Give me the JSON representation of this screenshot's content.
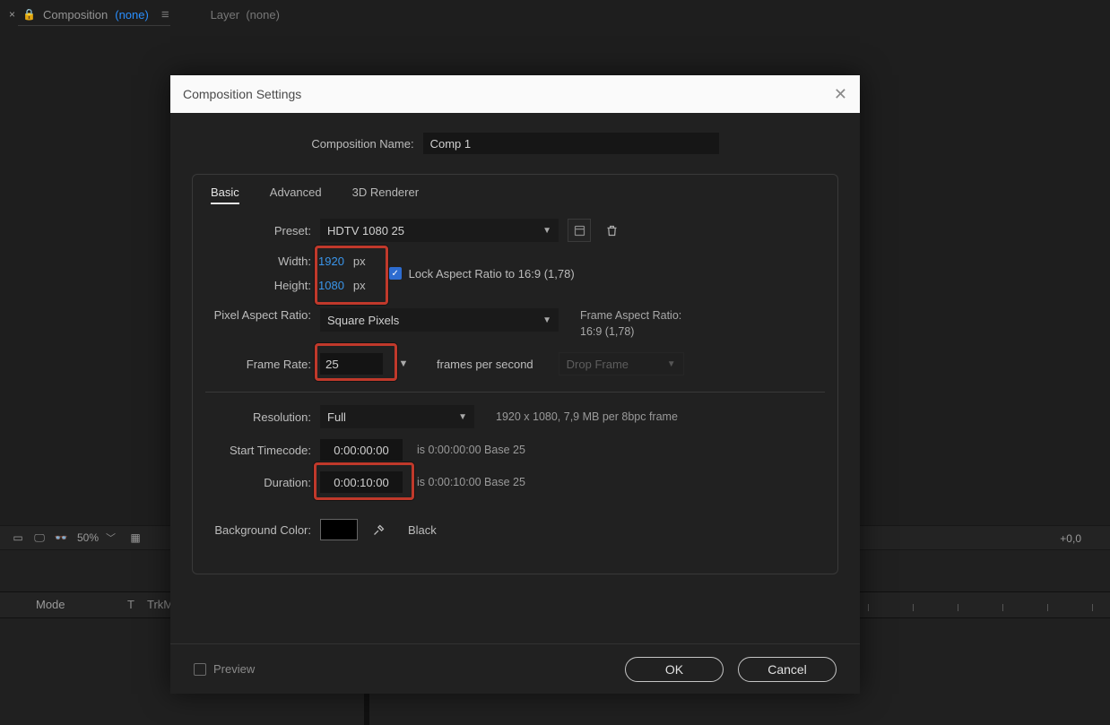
{
  "bg": {
    "comp_label": "Composition",
    "none_link": "(none)",
    "layer_label": "Layer",
    "layer_none": "(none)",
    "zoom": "50%",
    "plus_zero": "+0,0",
    "mode": "Mode",
    "t": "T",
    "trkm": "TrkM"
  },
  "dialog": {
    "title": "Composition Settings",
    "comp_name_label": "Composition Name:",
    "comp_name": "Comp 1",
    "tabs": {
      "basic": "Basic",
      "advanced": "Advanced",
      "renderer": "3D Renderer"
    },
    "preset_label": "Preset:",
    "preset_value": "HDTV 1080 25",
    "width_label": "Width:",
    "width_value": "1920",
    "height_label": "Height:",
    "height_value": "1080",
    "px": "px",
    "lock_label": "Lock Aspect Ratio to 16:9 (1,78)",
    "par_label": "Pixel Aspect Ratio:",
    "par_value": "Square Pixels",
    "far_label": "Frame Aspect Ratio:",
    "far_value": "16:9 (1,78)",
    "rate_label": "Frame Rate:",
    "rate_value": "25",
    "fps_label": "frames per second",
    "drop_value": "Drop Frame",
    "res_label": "Resolution:",
    "res_value": "Full",
    "res_info": "1920 x 1080, 7,9 MB per 8bpc frame",
    "tc_label": "Start Timecode:",
    "tc_value": "0:00:00:00",
    "tc_info": "is 0:00:00:00  Base 25",
    "dur_label": "Duration:",
    "dur_value": "0:00:10:00",
    "dur_info": "is 0:00:10:00  Base 25",
    "bg_label": "Background Color:",
    "bg_name": "Black",
    "preview": "Preview",
    "ok": "OK",
    "cancel": "Cancel"
  }
}
